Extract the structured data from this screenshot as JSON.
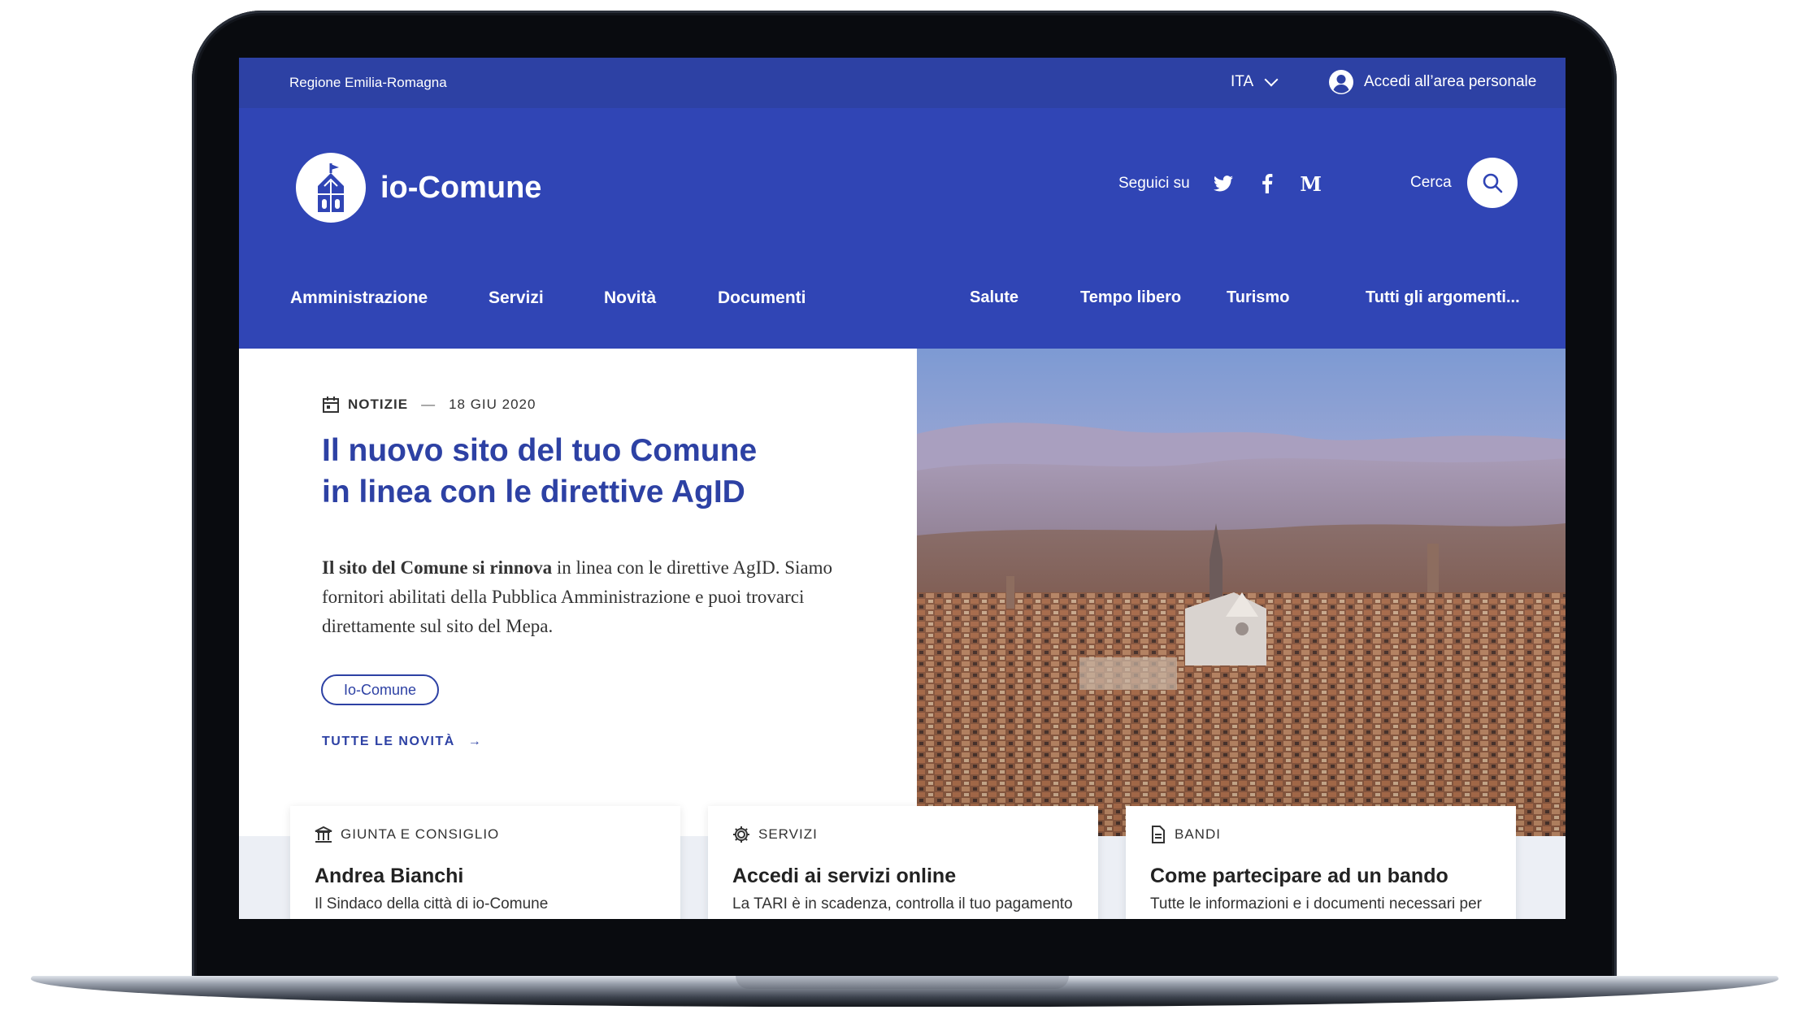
{
  "topbar": {
    "region": "Regione Emilia-Romagna",
    "language": "ITA",
    "login": "Accedi all’area personale"
  },
  "header": {
    "site_name": "io-Comune",
    "follow_label": "Seguici su",
    "search_label": "Cerca"
  },
  "main_nav": {
    "items": [
      "Amministrazione",
      "Servizi",
      "Novità",
      "Documenti"
    ]
  },
  "topic_nav": {
    "items": [
      "Salute",
      "Tempo libero",
      "Turismo"
    ],
    "all_topics": "Tutti gli argomenti..."
  },
  "hero": {
    "category": "NOTIZIE",
    "separator": "—",
    "date": "18 GIU 2020",
    "title": "Il nuovo sito del tuo Comune in linea con le direttive AgID",
    "text_bold": "Il sito del Comune si rinnova",
    "text_rest": " in linea con le direttive AgID. Siamo fornitori abilitati della Pubblica Amministrazione e puoi trovarci direttamente sul sito del Mepa.",
    "tag": "Io-Comune",
    "all_news": "TUTTE LE NOVITÀ"
  },
  "cards": [
    {
      "category": "GIUNTA E CONSIGLIO",
      "title": "Andrea Bianchi",
      "text": "Il Sindaco della città di io-Comune",
      "icon": "institution-icon"
    },
    {
      "category": "SERVIZI",
      "title": "Accedi ai servizi online",
      "text": "La TARI è in scadenza, controlla il tuo pagamento",
      "icon": "gear-icon"
    },
    {
      "category": "BANDI",
      "title": "Come partecipare ad un bando",
      "text": "Tutte le informazioni e i documenti necessari per",
      "icon": "document-icon"
    }
  ],
  "colors": {
    "primary": "#3045b5",
    "topbar": "#2d41a4",
    "title_blue": "#2d41a4"
  }
}
